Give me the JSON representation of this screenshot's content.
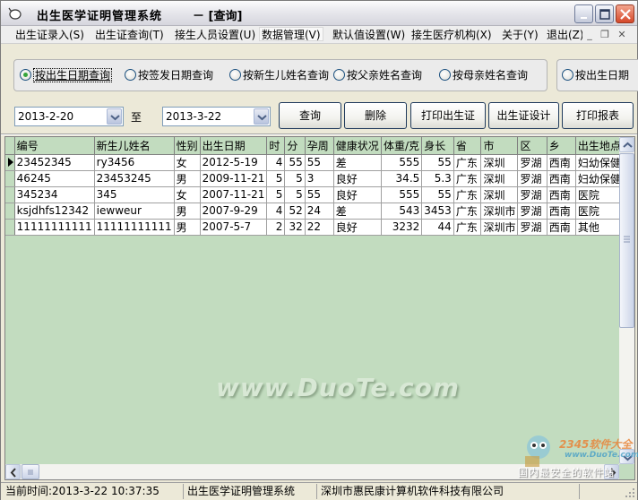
{
  "window": {
    "title": "出生医学证明管理系统",
    "subtitle": "－  [查询]"
  },
  "menu": {
    "items": [
      {
        "label": "出生证录入(S)"
      },
      {
        "label": "出生证查询(T)"
      },
      {
        "label": "接生人员设置(U)"
      },
      {
        "label": "数据管理(V)"
      },
      {
        "label": "默认值设置(W)"
      },
      {
        "label": "接生医疗机构(X)"
      },
      {
        "label": "关于(Y)"
      },
      {
        "label": "退出(Z)"
      }
    ],
    "mdi_controls": {
      "min": "_",
      "restore": "❐",
      "close": "✕"
    }
  },
  "query_options": {
    "options": [
      {
        "label": "按出生日期查询",
        "checked": true
      },
      {
        "label": "按签发日期查询",
        "checked": false
      },
      {
        "label": "按新生儿姓名查询",
        "checked": false
      },
      {
        "label": "按父亲姓名查询",
        "checked": false
      },
      {
        "label": "按母亲姓名查询",
        "checked": false
      }
    ],
    "extra_option": {
      "label": "按出生日期",
      "checked": false
    }
  },
  "date_range": {
    "from": "2013-2-20",
    "to_label": "至",
    "to": "2013-3-22"
  },
  "buttons": {
    "query": "查询",
    "delete": "删除",
    "print_cert": "打印出生证",
    "cert_design": "出生证设计",
    "print_report": "打印报表"
  },
  "grid": {
    "columns": [
      "编号",
      "新生儿姓名",
      "性别",
      "出生日期",
      "时",
      "分",
      "孕周",
      "健康状况",
      "体重/克",
      "身长",
      "省",
      "市",
      "区",
      "乡",
      "出生地点"
    ],
    "rows": [
      [
        "23452345",
        "ry3456",
        "女",
        "2012-5-19",
        "4",
        "55",
        "55",
        "差",
        "555",
        "55",
        "广东",
        "深圳",
        "罗湖",
        "西南",
        "妇幼保健院"
      ],
      [
        "46245",
        "23453245",
        "男",
        "2009-11-21",
        "5",
        "5",
        "3",
        "良好",
        "34.5",
        "5.3",
        "广东",
        "深圳",
        "罗湖",
        "西南",
        "妇幼保健院"
      ],
      [
        "345234",
        "345",
        "女",
        "2007-11-21",
        "5",
        "5",
        "55",
        "良好",
        "555",
        "55",
        "广东",
        "深圳",
        "罗湖",
        "西南",
        "医院"
      ],
      [
        "ksjdhfs12342",
        "iewweur",
        "男",
        "2007-9-29",
        "4",
        "52",
        "24",
        "差",
        "543",
        "3453",
        "广东",
        "深圳市",
        "罗湖",
        "西南",
        "医院"
      ],
      [
        "11111111111",
        "11111111111",
        "男",
        "2007-5-7",
        "2",
        "32",
        "22",
        "良好",
        "3232",
        "44",
        "广东",
        "深圳市",
        "罗湖",
        "西南",
        "其他"
      ]
    ],
    "selected_row": 0
  },
  "watermark": "www.DuoTe.com",
  "logo": {
    "brand": "2345软件大全",
    "url_text": "www.DuoTe.com",
    "slogan": "国内最安全的软件站"
  },
  "status": {
    "time": "当前时间:2013-3-22  10:37:35",
    "app": "出生医学证明管理系统",
    "company": "深圳市惠民康计算机软件科技有限公司"
  },
  "colors": {
    "grid_bg": "#c2dcbf",
    "accent_radio": "#35a43a"
  }
}
